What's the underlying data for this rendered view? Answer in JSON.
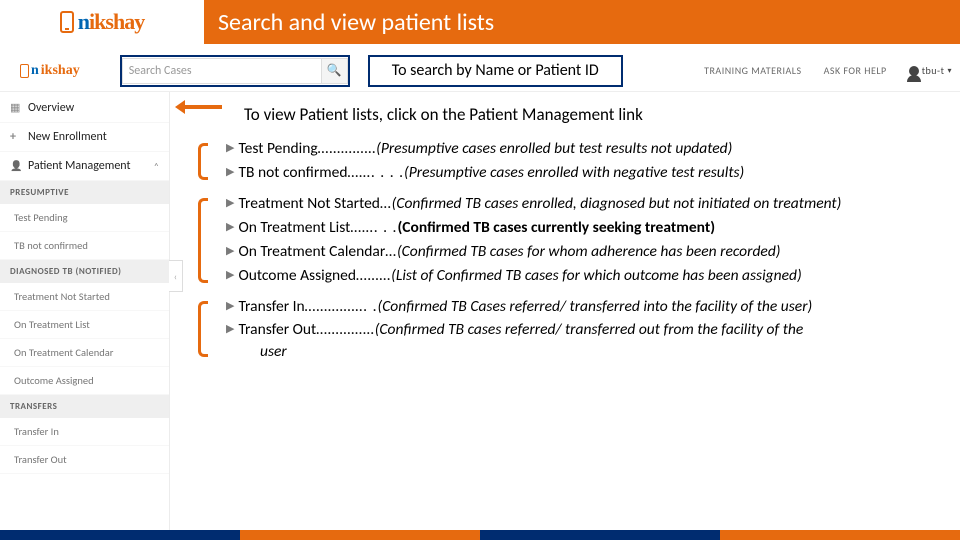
{
  "title": "Search and view patient lists",
  "brand": "nikshay",
  "search": {
    "placeholder": "Search Cases",
    "callout": "To search by Name or Patient ID"
  },
  "topnav": {
    "train": "TRAINING MATERIALS",
    "help": "ASK FOR HELP",
    "user": "tbu-t"
  },
  "sidebar": {
    "overview": "Overview",
    "new_enroll": "New Enrollment",
    "pm": "Patient Management",
    "sec_presumptive": "PRESUMPTIVE",
    "test_pending": "Test Pending",
    "tb_not_confirmed": "TB not confirmed",
    "sec_diag": "DIAGNOSED TB (NOTIFIED)",
    "tns": "Treatment Not Started",
    "otl": "On Treatment List",
    "otc": "On Treatment Calendar",
    "oa": "Outcome Assigned",
    "sec_transfers": "TRANSFERS",
    "tin": "Transfer In",
    "tout": "Transfer Out"
  },
  "hint": "To view Patient lists, click on the Patient Management link",
  "items": {
    "test_pending": {
      "label": "Test Pending",
      "dots": "……………",
      "desc": "(Presumptive cases enrolled but test results not updated)"
    },
    "tb_not_confirmed": {
      "label": "TB not confirmed",
      "dots": "……. . . . ",
      "desc": "(Presumptive cases enrolled with negative test results)"
    },
    "tns": {
      "label": "Treatment Not Started",
      "dots": "…",
      "desc": "(Confirmed TB cases enrolled, diagnosed but not initiated on treatment)"
    },
    "otl": {
      "label": "On Treatment List",
      "dots": "……. . . ",
      "desc": "(Confirmed TB cases currently seeking treatment)"
    },
    "otc": {
      "label": "On Treatment Calendar",
      "dots": "…",
      "desc": "(Confirmed TB cases for whom adherence has been recorded)"
    },
    "oa": {
      "label": "Outcome Assigned",
      "dots": "……… ",
      "desc": "(List of Confirmed TB cases for which outcome has been assigned)"
    },
    "tin": {
      "label": "Transfer In",
      "dots": "……………. . ",
      "desc": "(Confirmed TB Cases referred/ transferred into the facility of the user)"
    },
    "tout": {
      "label": "Transfer Out",
      "dots": "……………",
      "desc": "(Confirmed TB cases referred/ transferred out from the facility of the",
      "tail": "user"
    }
  }
}
